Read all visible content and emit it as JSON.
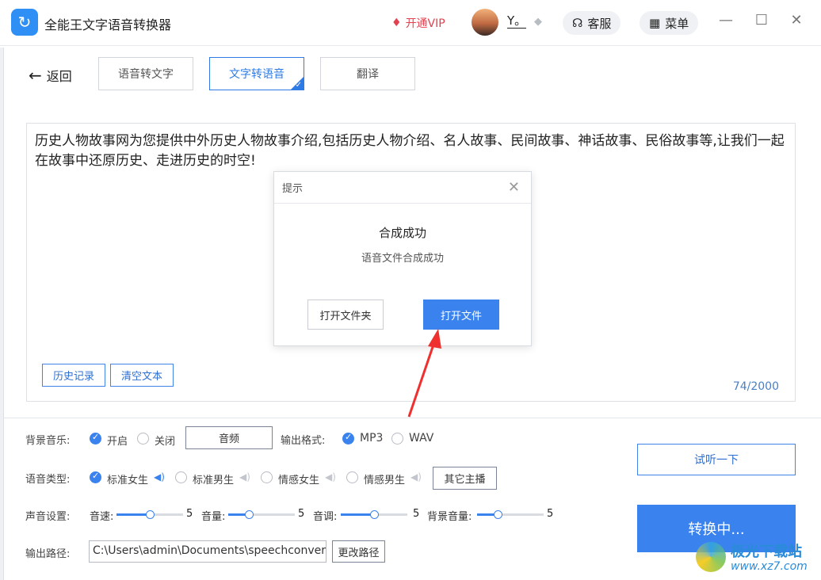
{
  "app": {
    "title": "全能王文字语音转换器",
    "vip": "开通VIP",
    "username": "Y。",
    "service": "客服",
    "menu": "菜单"
  },
  "nav": {
    "back": "返回",
    "tabs": [
      {
        "label": "语音转文字"
      },
      {
        "label": "文字转语音"
      },
      {
        "label": "翻译"
      }
    ]
  },
  "editor": {
    "text": "历史人物故事网为您提供中外历史人物故事介绍,包括历史人物介绍、名人故事、民间故事、神话故事、民俗故事等,让我们一起在故事中还原历史、走进历史的时空!",
    "history_btn": "历史记录",
    "clear_btn": "清空文本",
    "counter": "74/2000"
  },
  "dialog": {
    "header": "提示",
    "title": "合成成功",
    "subtitle": "语音文件合成成功",
    "open_folder": "打开文件夹",
    "open_file": "打开文件"
  },
  "settings": {
    "bg_music": {
      "label": "背景音乐:",
      "on": "开启",
      "off": "关闭",
      "audio_btn": "音频"
    },
    "format": {
      "label": "输出格式:",
      "mp3": "MP3",
      "wav": "WAV"
    },
    "voice": {
      "label": "语音类型:",
      "options": [
        "标准女生",
        "标准男生",
        "情感女生",
        "情感男生"
      ],
      "more": "其它主播"
    },
    "sound": {
      "label": "声音设置:",
      "speed_label": "音速:",
      "speed": "5",
      "volume_label": "音量:",
      "volume": "5",
      "pitch_label": "音调:",
      "pitch": "5",
      "bgvol_label": "背景音量:",
      "bgvol": "5"
    },
    "output": {
      "label": "输出路径:",
      "path": "C:\\Users\\admin\\Documents\\speechconvert_v",
      "change_btn": "更改路径"
    }
  },
  "actions": {
    "preview": "试听一下",
    "convert": "转换中..."
  },
  "watermark": {
    "name": "极光下载站",
    "url": "www.xz7.com"
  }
}
